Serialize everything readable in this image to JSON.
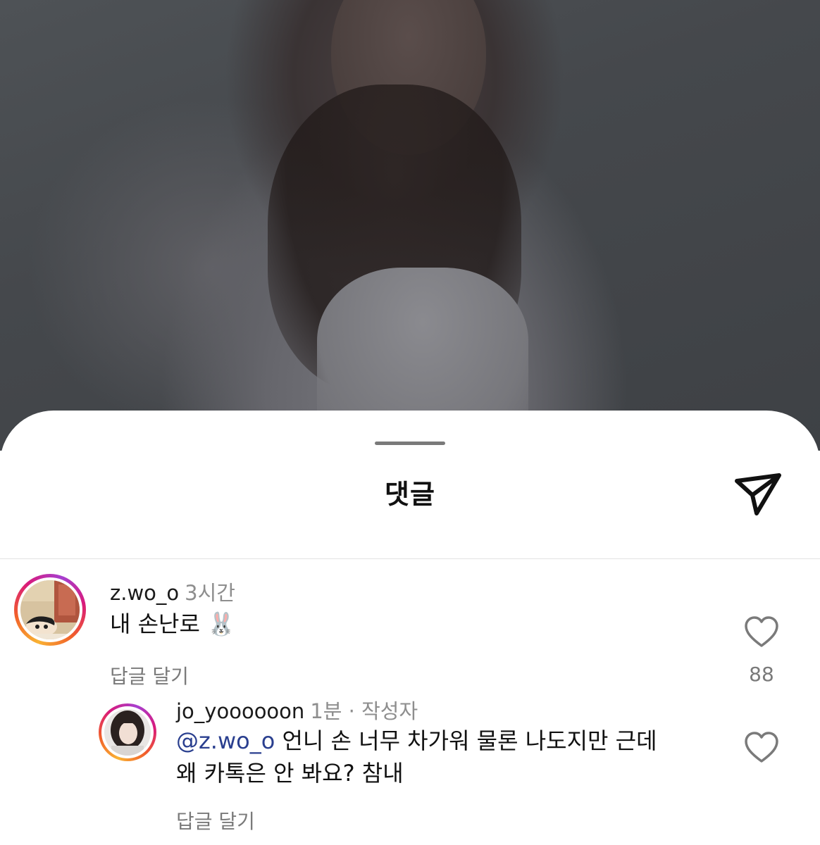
{
  "sheet": {
    "title": "댓글",
    "share_icon": "paper-plane-icon"
  },
  "comments": [
    {
      "username": "z.wo_o",
      "time": "3시간",
      "text": "내 손난로 🐰",
      "reply_label": "답글 달기",
      "like_count": "88",
      "avatar": "cartoon-avatar"
    }
  ],
  "replies": [
    {
      "username": "jo_yoooooon",
      "time": "1분 · 작성자",
      "mention": "@z.wo_o",
      "text_line1": " 언니 손 너무 차가워 물론 나도지만 근데",
      "text_line2": "왜 카톡은 안 봐요? 참내",
      "reply_label": "답글 달기",
      "avatar": "profile-photo-avatar"
    }
  ],
  "colors": {
    "mention": "#2a3f8f",
    "secondary_text": "#8e8e8e",
    "story_ring_start": "#f9b233",
    "story_ring_end": "#d91a7b"
  }
}
